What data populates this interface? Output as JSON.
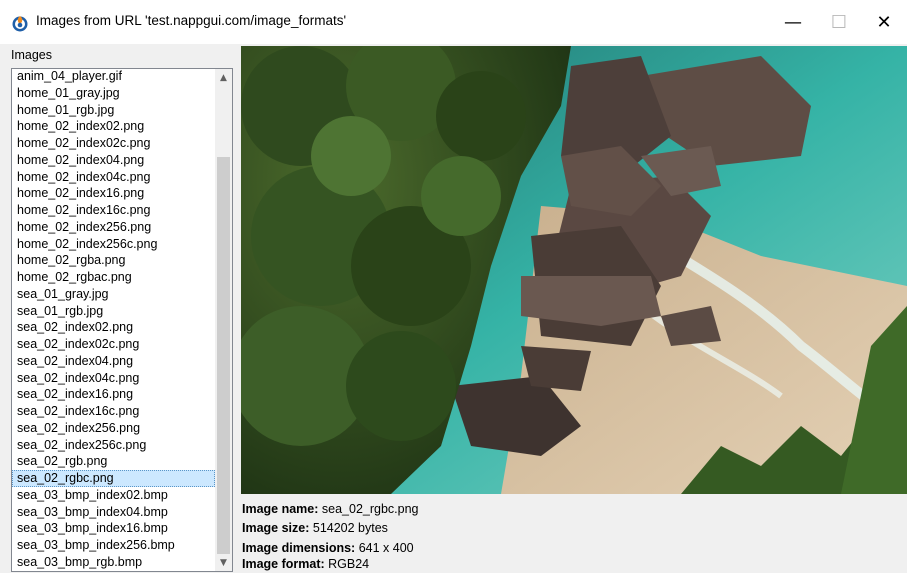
{
  "window": {
    "title": "Images from URL 'test.nappgui.com/image_formats'",
    "controls": {
      "minimize": "—",
      "maximize": "☐",
      "close": "✕"
    }
  },
  "images_panel": {
    "label": "Images",
    "items": [
      "anim_04_player.gif",
      "home_01_gray.jpg",
      "home_01_rgb.jpg",
      "home_02_index02.png",
      "home_02_index02c.png",
      "home_02_index04.png",
      "home_02_index04c.png",
      "home_02_index16.png",
      "home_02_index16c.png",
      "home_02_index256.png",
      "home_02_index256c.png",
      "home_02_rgba.png",
      "home_02_rgbac.png",
      "sea_01_gray.jpg",
      "sea_01_rgb.jpg",
      "sea_02_index02.png",
      "sea_02_index02c.png",
      "sea_02_index04.png",
      "sea_02_index04c.png",
      "sea_02_index16.png",
      "sea_02_index16c.png",
      "sea_02_index256.png",
      "sea_02_index256c.png",
      "sea_02_rgb.png",
      "sea_02_rgbc.png",
      "sea_03_bmp_index02.bmp",
      "sea_03_bmp_index04.bmp",
      "sea_03_bmp_index16.bmp",
      "sea_03_bmp_index256.bmp",
      "sea_03_bmp_rgb.bmp"
    ],
    "selected_index": 24
  },
  "image_info": {
    "name_label": "Image name:",
    "name_value": "sea_02_rgbc.png",
    "size_label": "Image size:",
    "size_value": "514202 bytes",
    "dimensions_label": "Image dimensions:",
    "dimensions_value": "641 x 400",
    "format_label": "Image format:",
    "format_value": "RGB24"
  },
  "colors": {
    "selection": "#cce8ff",
    "sea": "#3bb5a8",
    "sand": "#d9c3a4",
    "rock": "#5a4a42",
    "foliage": "#2f4a1e"
  }
}
